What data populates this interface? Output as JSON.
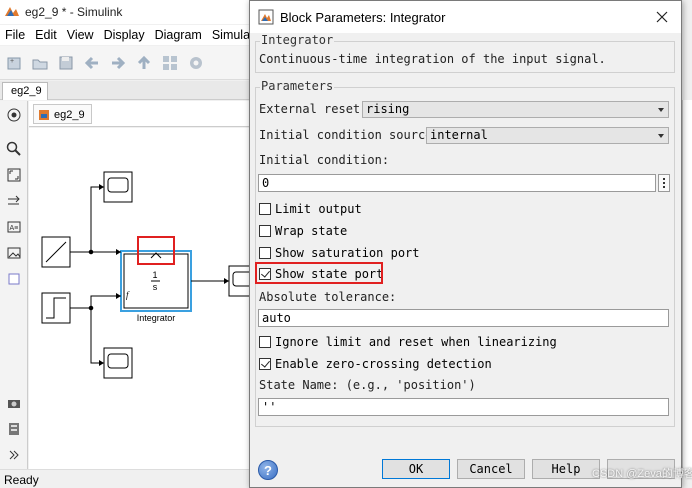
{
  "simulink": {
    "window_title": "eg2_9 * - Simulink",
    "menu": [
      "File",
      "Edit",
      "View",
      "Display",
      "Diagram",
      "Simula"
    ],
    "tab": "eg2_9",
    "breadcrumb": "eg2_9",
    "status": "Ready",
    "integrator_label": "Integrator",
    "integrator_num": "1",
    "integrator_den": "s",
    "reset_mark": "f"
  },
  "dialog": {
    "title": "Block Parameters: Integrator",
    "group_label": "Integrator",
    "description": "Continuous-time integration of the input signal.",
    "params_label": "Parameters",
    "external_reset_label": "External reset:",
    "external_reset_value": "rising",
    "ic_source_label": "Initial condition source:",
    "ic_source_value": "internal",
    "ic_label": "Initial condition:",
    "ic_value": "0",
    "limit_output": "Limit output",
    "wrap_state": "Wrap state",
    "show_saturation": "Show saturation port",
    "show_state": "Show state port",
    "abs_tol_label": "Absolute tolerance:",
    "abs_tol_value": "auto",
    "ignore_limit": "Ignore limit and reset when linearizing",
    "zero_crossing": "Enable zero-crossing detection",
    "state_name_label": "State Name: (e.g., 'position')",
    "state_name_value": "''",
    "ok": "OK",
    "cancel": "Cancel",
    "help": "Help",
    "help_icon": "?"
  },
  "watermark": "CSDN @Zeva的博客",
  "colors": {
    "accent": "#0078d7",
    "highlight": "#e02020",
    "block_border": "#3aa0e0"
  }
}
